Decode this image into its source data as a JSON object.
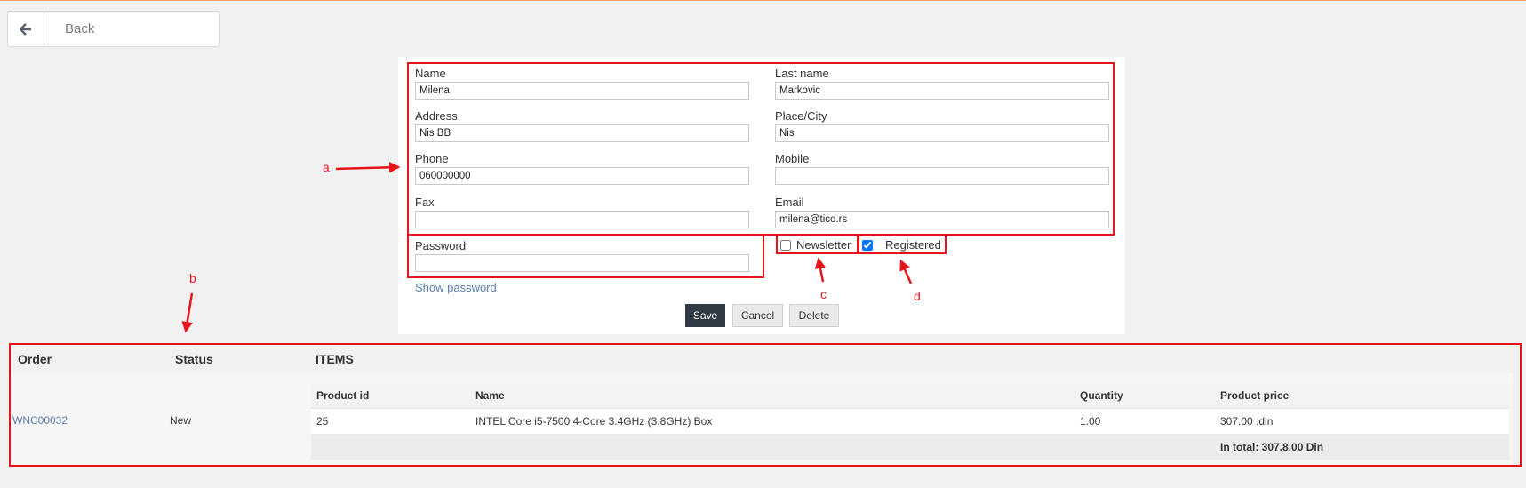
{
  "back": {
    "label": "Back",
    "icon": "arrow-left-icon"
  },
  "form": {
    "name": {
      "label": "Name",
      "value": "Milena"
    },
    "last_name": {
      "label": "Last name",
      "value": "Markovic"
    },
    "address": {
      "label": "Address",
      "value": "Nis BB"
    },
    "city": {
      "label": "Place/City",
      "value": "Nis"
    },
    "phone": {
      "label": "Phone",
      "value": "060000000"
    },
    "mobile": {
      "label": "Mobile",
      "value": ""
    },
    "fax": {
      "label": "Fax",
      "value": ""
    },
    "email": {
      "label": "Email",
      "value": "milena@tico.rs"
    },
    "password": {
      "label": "Password",
      "value": ""
    },
    "newsletter": {
      "label": "Newsletter",
      "checked": false
    },
    "registered": {
      "label": "Registered",
      "checked": true
    },
    "show_password": "Show password",
    "buttons": {
      "save": "Save",
      "cancel": "Cancel",
      "delete": "Delete"
    }
  },
  "annotations": {
    "a": "a",
    "b": "b",
    "c": "c",
    "d": "d",
    "color": "#e8141c"
  },
  "orders": {
    "headers": {
      "order": "Order",
      "status": "Status",
      "items": "ITEMS"
    },
    "rows": [
      {
        "order": "WNC00032",
        "status": "New",
        "items_headers": [
          "Product id",
          "Name",
          "Quantity",
          "Product price"
        ],
        "items": [
          {
            "product_id": "25",
            "name": "INTEL Core i5-7500 4-Core 3.4GHz (3.8GHz) Box",
            "quantity": "1.00",
            "price": "307.00 .din"
          }
        ],
        "total": "In total: 307.8.00 Din"
      }
    ]
  },
  "colors": {
    "accent_dark": "#2f3a44",
    "link": "#5a7fa8",
    "annotation": "#e8141c"
  }
}
